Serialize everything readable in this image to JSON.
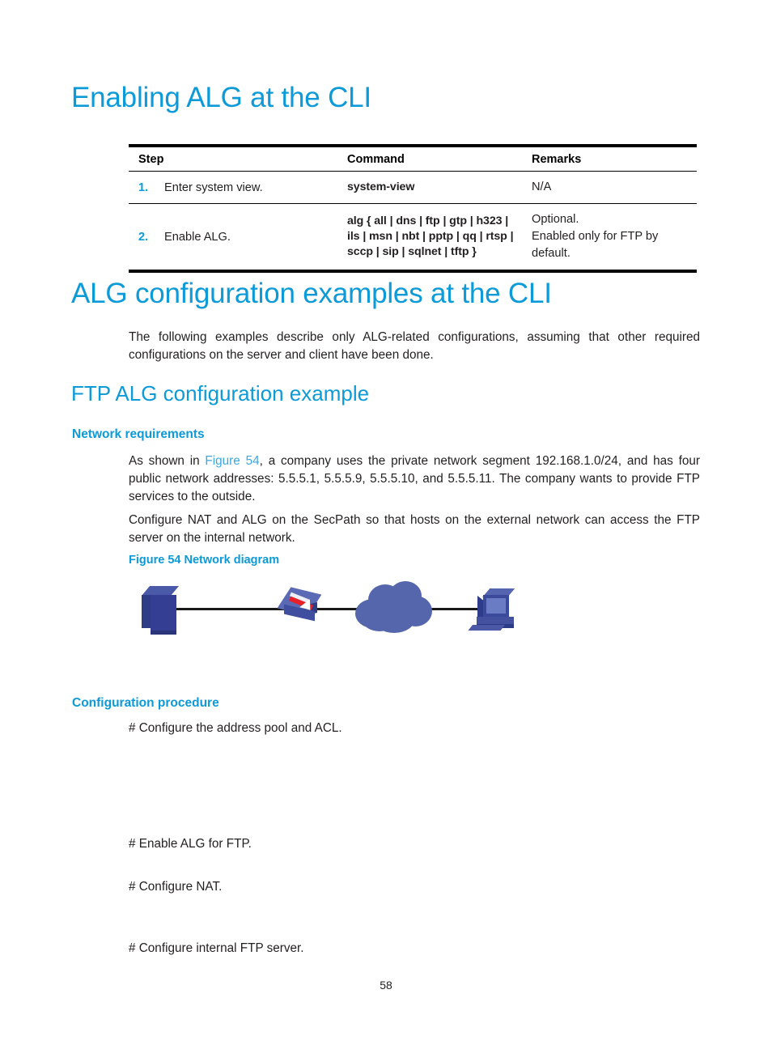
{
  "page": {
    "number": "58",
    "heading_color": "#0c9ad8",
    "xref_color": "#3aa8e0"
  },
  "section_alg_cli": {
    "title": "Enabling ALG at the CLI",
    "table": {
      "headers": [
        "Step",
        "Command",
        "Remarks"
      ],
      "rows": [
        {
          "num": "1.",
          "step": "Enter system view.",
          "command": "system-view",
          "command_lines": [
            "system-view"
          ],
          "remarks": [
            "N/A"
          ]
        },
        {
          "num": "2.",
          "step": "Enable ALG.",
          "command": "alg { all | dns | ftp | gtp | h323 | ils | msn | nbt | pptp | qq | rtsp | sccp | sip | sqlnet | tftp }",
          "command_lines": [
            "alg { all | dns | ftp | gtp | h323 |",
            "ils | msn | nbt | pptp | qq | rtsp |",
            "sccp | sip | sqlnet | tftp }"
          ],
          "remarks": [
            "Optional.",
            "Enabled only for FTP by default."
          ]
        }
      ]
    }
  },
  "section_examples": {
    "title": "ALG configuration examples at the CLI",
    "intro": "The following examples describe only ALG-related configurations, assuming that other required configurations on the server and client have been done."
  },
  "section_ftp": {
    "title": "FTP ALG configuration example",
    "network_requirements": {
      "heading": "Network requirements",
      "para1_before_xref": "As shown in ",
      "para1_xref": "Figure 54",
      "para1_after_xref": ", a company uses the private network segment 192.168.1.0/24, and has four public network addresses: 5.5.5.1, 5.5.5.9, 5.5.5.10, and 5.5.5.11. The company wants to provide FTP services to the outside.",
      "para2": "Configure NAT and ALG on the SecPath so that hosts on the external network can access the FTP server on the internal network."
    },
    "figure": {
      "caption": "Figure 54 Network diagram",
      "nodes": [
        {
          "name": "server",
          "label": ""
        },
        {
          "name": "firewall",
          "label": ""
        },
        {
          "name": "cloud",
          "label": ""
        },
        {
          "name": "pc",
          "label": ""
        }
      ]
    },
    "configuration_procedure": {
      "heading": "Configuration procedure",
      "steps": [
        "# Configure the address pool and ACL.",
        "# Enable ALG for FTP.",
        "# Configure NAT.",
        "# Configure internal FTP server."
      ]
    }
  }
}
